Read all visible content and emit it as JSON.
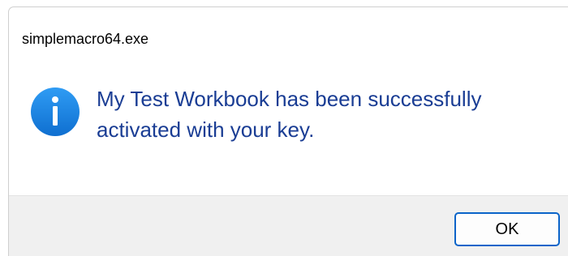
{
  "window": {
    "title": "simplemacro64.exe"
  },
  "message": {
    "icon": "info-icon",
    "text": "My Test Workbook has been successfully activated with your key."
  },
  "buttons": {
    "ok_label": "OK"
  },
  "colors": {
    "accent": "#0a64c9",
    "message_text": "#1a3d94",
    "icon_fill": "#1e88e5",
    "footer_bg": "#f0f0f0"
  }
}
